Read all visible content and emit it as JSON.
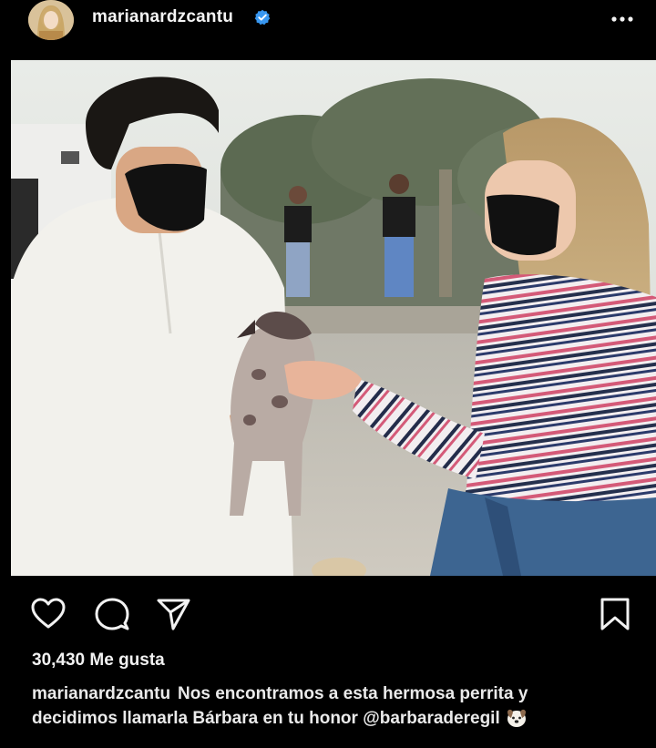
{
  "post": {
    "username": "marianardzcantu",
    "likes": "30,430 Me gusta",
    "caption_user": "marianardzcantu",
    "caption_line1": "Nos encontramos a esta hermosa perrita y",
    "caption_line2": "decidimos llamarla Bárbara en tu honor @barbaraderegil",
    "caption_emoji": "dog-face-icon"
  },
  "icons": {
    "verified": "verified-badge-icon",
    "more": "more-options-icon",
    "like": "heart-icon",
    "comment": "comment-icon",
    "share": "send-icon",
    "save": "bookmark-icon"
  },
  "colors": {
    "background": "#000000",
    "text": "#f2f2f2",
    "verified": "#3897f0"
  }
}
